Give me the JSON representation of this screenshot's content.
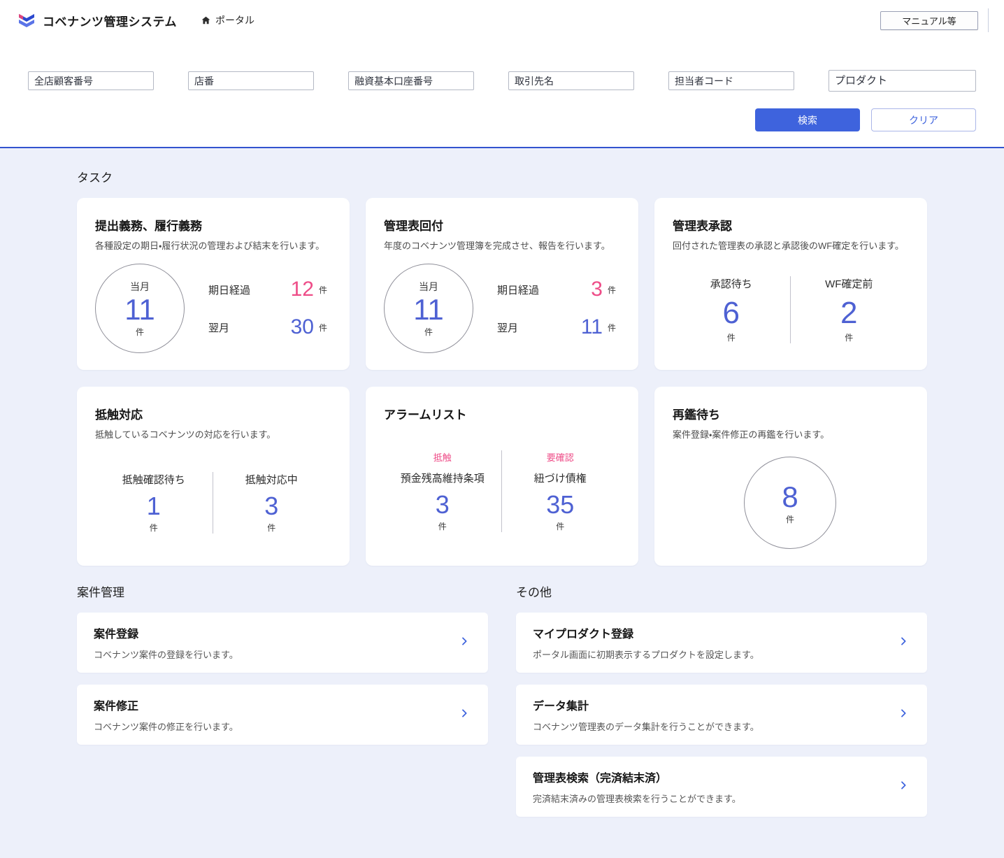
{
  "colors": {
    "accent": "#3e63dd",
    "stat_blue": "#4e61d3",
    "pink": "#ee4d88",
    "background": "#edf0fa"
  },
  "header": {
    "app_title": "コベナンツ管理システム",
    "portal_label": "ポータル",
    "manual_button": "マニュアル等"
  },
  "search": {
    "fields": [
      {
        "placeholder": "全店顧客番号"
      },
      {
        "placeholder": "店番"
      },
      {
        "placeholder": "融資基本口座番号"
      },
      {
        "placeholder": "取引先名"
      },
      {
        "placeholder": "担当者コード"
      },
      {
        "placeholder": "プロダクト"
      }
    ],
    "search_button": "検索",
    "clear_button": "クリア"
  },
  "tasks": {
    "title": "タスク",
    "card1": {
      "title": "提出義務、履行義務",
      "desc": "各種設定の期日・履行状況の管理および結末を行います。",
      "circle": {
        "label": "当月",
        "value": "11",
        "unit": "件"
      },
      "row1": {
        "label": "期日経過",
        "value": "12",
        "unit": "件"
      },
      "row2": {
        "label": "翌月",
        "value": "30",
        "unit": "件"
      }
    },
    "card2": {
      "title": "管理表回付",
      "desc": "年度のコベナンツ管理簿を完成させ、報告を行います。",
      "circle": {
        "label": "当月",
        "value": "11",
        "unit": "件"
      },
      "row1": {
        "label": "期日経過",
        "value": "3",
        "unit": "件"
      },
      "row2": {
        "label": "翌月",
        "value": "11",
        "unit": "件"
      }
    },
    "card3": {
      "title": "管理表承認",
      "desc": "回付された管理表の承認と承認後のWF確定を行います。",
      "stat1": {
        "label": "承認待ち",
        "value": "6",
        "unit": "件"
      },
      "stat2": {
        "label": "WF確定前",
        "value": "2",
        "unit": "件"
      }
    },
    "card4": {
      "title": "抵触対応",
      "desc": "抵触しているコベナンツの対応を行います。",
      "stat1": {
        "label": "抵触確認待ち",
        "value": "1",
        "unit": "件"
      },
      "stat2": {
        "label": "抵触対応中",
        "value": "3",
        "unit": "件"
      }
    },
    "card5": {
      "title": "アラームリスト",
      "stat1": {
        "tag": "抵触",
        "label": "預金残高維持条項",
        "value": "3",
        "unit": "件"
      },
      "stat2": {
        "tag": "要確認",
        "label": "紐づけ債権",
        "value": "35",
        "unit": "件"
      }
    },
    "card6": {
      "title": "再鑑待ち",
      "desc": "案件登録・案件修正の再鑑を行います。",
      "circle": {
        "value": "8",
        "unit": "件"
      }
    }
  },
  "sections": {
    "case_management": {
      "title": "案件管理",
      "links": [
        {
          "title": "案件登録",
          "desc": "コベナンツ案件の登録を行います。"
        },
        {
          "title": "案件修正",
          "desc": "コベナンツ案件の修正を行います。"
        }
      ]
    },
    "others": {
      "title": "その他",
      "links": [
        {
          "title": "マイプロダクト登録",
          "desc": "ポータル画面に初期表示するプロダクトを設定します。"
        },
        {
          "title": "データ集計",
          "desc": "コベナンツ管理表のデータ集計を行うことができます。"
        },
        {
          "title": "管理表検索（完済結末済）",
          "desc": "完済結末済みの管理表検索を行うことができます。"
        }
      ]
    }
  }
}
